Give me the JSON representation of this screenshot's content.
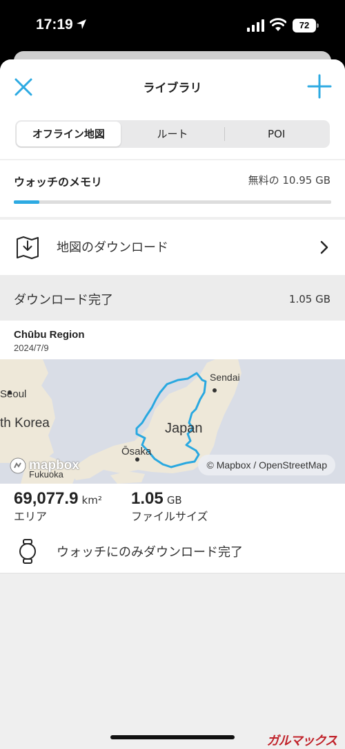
{
  "status": {
    "time": "17:19",
    "battery": "72"
  },
  "header": {
    "title": "ライブラリ"
  },
  "tabs": [
    {
      "label": "オフライン地図",
      "active": true
    },
    {
      "label": "ルート",
      "active": false
    },
    {
      "label": "POI",
      "active": false
    }
  ],
  "memory": {
    "label": "ウォッチのメモリ",
    "free_text": "無料の 10.95 GB",
    "used_fraction": 0.08
  },
  "download_maps": {
    "label": "地図のダウンロード"
  },
  "completed": {
    "label": "ダウンロード完了",
    "size": "1.05 GB",
    "map": {
      "region": "Chūbu Region",
      "date": "2024/7/9",
      "labels": {
        "sendai": "Sendai",
        "seoul": "Seoul",
        "korea": "th Korea",
        "japan": "Japan",
        "osaka": "Ōsaka",
        "fukuoka": "Fukuoka"
      },
      "logo_text": "mapbox",
      "attribution": "© Mapbox / OpenStreetMap"
    },
    "area": {
      "value": "69,077.9",
      "unit": "km²",
      "label": "エリア"
    },
    "file_size": {
      "value": "1.05",
      "unit": "GB",
      "label": "ファイルサイズ"
    },
    "watch_status": "ウォッチにのみダウンロード完了"
  },
  "watermark": "ガルマックス",
  "colors": {
    "accent": "#2daae2",
    "route": "#29a8e0"
  }
}
